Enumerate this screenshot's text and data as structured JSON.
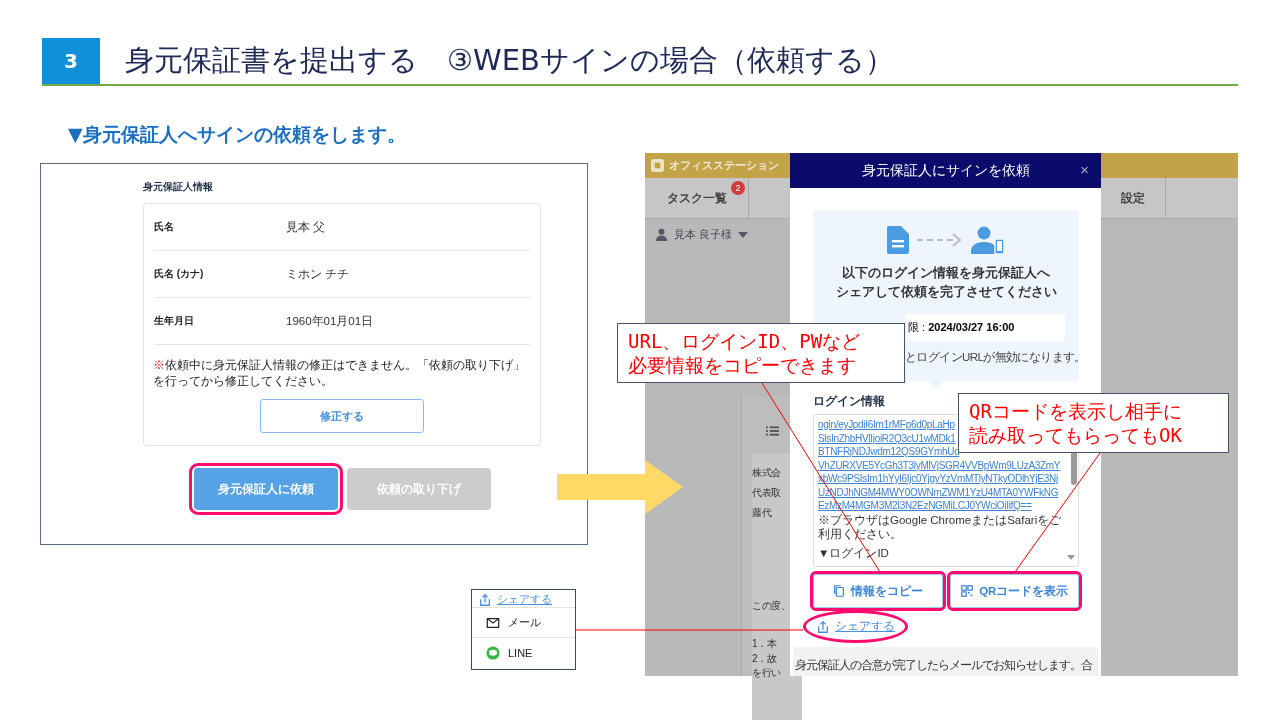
{
  "slide": {
    "step_number": "3",
    "title": "身元保証書を提出する　③WEBサインの場合（依頼する）",
    "subtitle": "▼身元保証人へサインの依頼をします。"
  },
  "left_screen": {
    "section_title": "身元保証人情報",
    "fields": [
      {
        "label": "氏名",
        "value": "見本 父"
      },
      {
        "label": "氏名 (カナ)",
        "value": "ミホン チチ"
      },
      {
        "label": "生年月日",
        "value": "1960年01月01日"
      }
    ],
    "notice_mark": "※",
    "notice": "依頼中に身元保証人情報の修正はできません。「依頼の取り下げ」を行ってから修正してください。",
    "edit_button": "修正する",
    "buttons": [
      {
        "label": "身元保証人に依頼",
        "disabled": false,
        "highlighted": true
      },
      {
        "label": "依頼の取り下げ",
        "disabled": true,
        "highlighted": false
      }
    ]
  },
  "right_screen": {
    "app_name": "オフィスステーション",
    "tabs": [
      {
        "label": "タスク一覧",
        "badge": "2"
      },
      {
        "label": "設定"
      }
    ],
    "user": "見本 良子様",
    "document_lines": [
      "株式会",
      "代表取",
      "藤代",
      "この度、",
      "1．本",
      "2．故",
      "を行い"
    ],
    "modal": {
      "title": "身元保証人にサインを依頼",
      "close": "×",
      "instruction_lines": [
        "以下のログイン情報を身元保証人へ",
        "シェアして依頼を完了させてください"
      ],
      "deadline": "限 : **2024/03/27 16:00**",
      "expiry_note": "とログインURLが無効になります。",
      "login_label": "ログイン情報",
      "url_lines": [
        "ogin/eyJpdiI6Im1rMFp6d0pLaHp",
        "SlsInZhbHVlIjoiR2Q3cU1wMDk1",
        "BTNFRjNDJwdm12QS9GYmhUd",
        "VhZURXVE5YcGh3T3lyMlVjSGR4VVBpWm9LUzA3ZmY",
        "xbWc9PSIsIm1hYyI6Ijc0YjgyYzVmMTlyNTkyODlhYjE3Nj",
        "UzNDJhNGM4MWY0OWNmZWM1YzU4MTA0YWFkNG",
        "EzMzM4MGM3M2I3N2EzNGMiLCJ0YWciOiIifQ=="
      ],
      "browser_note": "※ブラウザはGoogle ChromeまたはSafariをご利用ください。",
      "login_id_heading": "▼ログインID",
      "actions": [
        {
          "kind": "copy",
          "label": "情報をコピー",
          "highlighted": true
        },
        {
          "kind": "qr",
          "label": "QRコードを表示",
          "highlighted": true
        }
      ],
      "share_link": "シェアする",
      "share_highlighted": true,
      "footer_note": "身元保証人の合意が完了したらメールでお知らせします。合"
    }
  },
  "share_menu": {
    "link": "シェアする",
    "items": [
      {
        "kind": "mail",
        "label": "メール"
      },
      {
        "kind": "line",
        "label": "LINE"
      }
    ]
  },
  "callouts": [
    {
      "lines": [
        "URL、ログインID、PWなど",
        "必要情報をコピーできます"
      ]
    },
    {
      "lines": [
        "QRコードを表示し相手に",
        "読み取ってもらってもOK"
      ]
    }
  ]
}
